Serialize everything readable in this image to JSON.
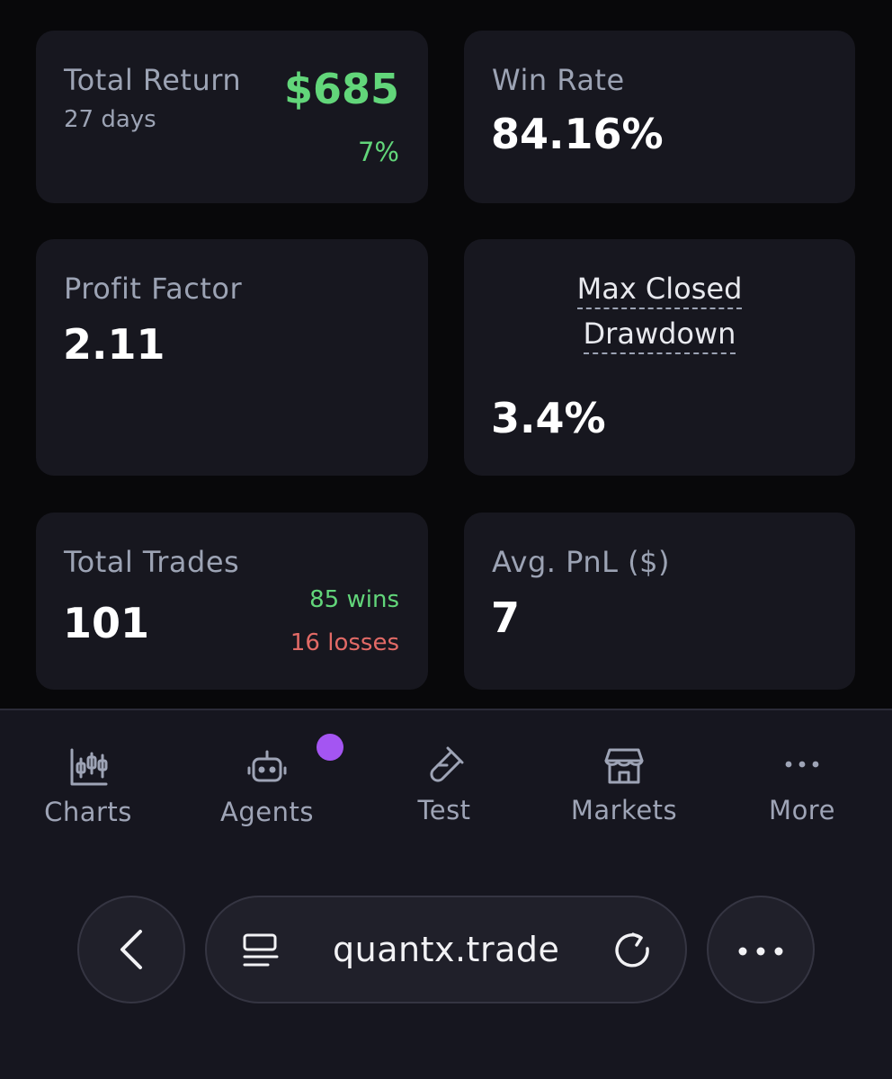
{
  "stats": {
    "total_return": {
      "label": "Total Return",
      "period": "27 days",
      "value": "$685",
      "percent": "7%"
    },
    "win_rate": {
      "label": "Win Rate",
      "value": "84.16%"
    },
    "profit_factor": {
      "label": "Profit Factor",
      "value": "2.11"
    },
    "max_drawdown": {
      "label_line1": "Max Closed",
      "label_line2": "Drawdown",
      "value": "3.4%"
    },
    "total_trades": {
      "label": "Total Trades",
      "value": "101",
      "wins": "85 wins",
      "losses": "16 losses"
    },
    "avg_pnl": {
      "label": "Avg. PnL ($)",
      "value": "7"
    }
  },
  "nav": {
    "items": [
      {
        "label": "Charts",
        "icon": "candlestick-chart-icon"
      },
      {
        "label": "Agents",
        "icon": "robot-icon"
      },
      {
        "label": "Test",
        "icon": "test-tube-icon"
      },
      {
        "label": "Markets",
        "icon": "storefront-icon"
      },
      {
        "label": "More",
        "icon": "more-horizontal-icon"
      }
    ]
  },
  "browser": {
    "url": "quantx.trade"
  },
  "colors": {
    "background": "#08080a",
    "card": "#17171f",
    "positive": "#62d67a",
    "negative": "#e26a66",
    "notification": "#a455f2"
  }
}
